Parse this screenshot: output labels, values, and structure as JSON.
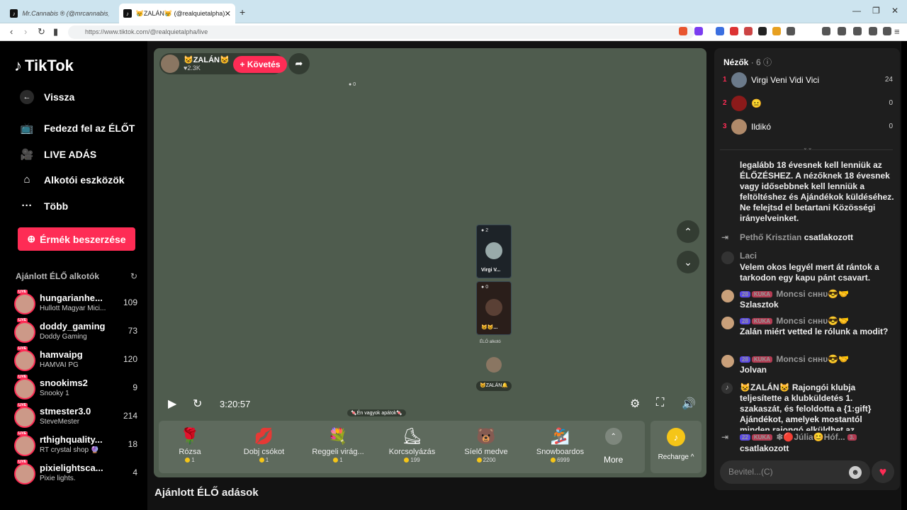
{
  "browser": {
    "tabs": [
      {
        "title": "Mr.Cannabis ® (@mrcannabis_",
        "active": false
      },
      {
        "title": "😿ZALÁN😿 (@realquietalpha)",
        "active": true
      }
    ],
    "url": "https://www.tiktok.com/@realquietalpha/live"
  },
  "sidebar": {
    "logo": "TikTok",
    "back": "Vissza",
    "nav": [
      "Fedezd fel az ÉLŐT",
      "LIVE ADÁS",
      "Alkotói eszközök",
      "Több"
    ],
    "coins_button": "Érmék beszerzése",
    "recommended_title": "Ajánlott ÉLŐ alkotók",
    "live_badge": "LIVE",
    "creators": [
      {
        "name": "hungarianhe...",
        "sub": "Hullott Magyar Mici...",
        "count": "109"
      },
      {
        "name": "doddy_gaming",
        "sub": "Doddy Gaming",
        "count": "73"
      },
      {
        "name": "hamvaipg",
        "sub": "HAMVAI PG",
        "count": "120"
      },
      {
        "name": "snookims2",
        "sub": "Snooky 1",
        "count": "9"
      },
      {
        "name": "stmester3.0",
        "sub": "SteveMester",
        "count": "214"
      },
      {
        "name": "rthighquality...",
        "sub": "RT crystal shop 🔮",
        "count": "18"
      },
      {
        "name": "pixielightsca...",
        "sub": "Pixie lights.",
        "count": "4"
      }
    ]
  },
  "bottom_heading": "Ajánlott ÉLŐ adások",
  "stage": {
    "host_name": "😺ZALÁN😺",
    "host_likes": "♥2.3K",
    "follow": "+ Követés",
    "top_count": "0",
    "guests": [
      {
        "count": "2",
        "name": "Virgi V..."
      },
      {
        "count": "0",
        "name": "😺😺..."
      }
    ],
    "live_creator_label": "ÉLŐ alkotó",
    "host_mini_label": "😺ZALÁN🔔",
    "time": "3:20:57",
    "banner": "🍬Én vagyok apátok🍬",
    "gifts": [
      {
        "name": "Rózsa",
        "price": "1",
        "icon": "🌹"
      },
      {
        "name": "Dobj csókot",
        "price": "1",
        "icon": "💋"
      },
      {
        "name": "Reggeli virág...",
        "price": "1",
        "icon": "💐"
      },
      {
        "name": "Korcsolyázás",
        "price": "199",
        "icon": "⛸"
      },
      {
        "name": "Síelő medve",
        "price": "2200",
        "icon": "🐻"
      },
      {
        "name": "Snowboardos",
        "price": "6999",
        "icon": "🏂"
      }
    ],
    "more": "More",
    "recharge": "Recharge ^"
  },
  "chat": {
    "viewers_title": "Nézők",
    "viewers_count": "· 6",
    "viewers": [
      {
        "rank": "1",
        "name": "Virgi Veni Vidi Vici",
        "score": "24"
      },
      {
        "rank": "2",
        "name": "😐",
        "score": "0"
      },
      {
        "rank": "3",
        "name": "Ildikó",
        "score": "0"
      }
    ],
    "notice": "legalább 18 évesnek kell lenniük az ÉLŐZÉSHEZ. A nézőknek 18 évesnek vagy idősebbnek kell lenniük a feltöltéshez és Ajándékok küldéséhez. Ne felejtsd el betartani Közösségi irányelveinket.",
    "join1_user": "Pethő Krisztian",
    "join1_text": "csatlakozott",
    "laci_user": "Laci",
    "laci_text": "Velem okos legyél mert át rántok a tarkodon egy kapu pánt csavart.",
    "badge_level": "28",
    "badge_club": "KUKA",
    "moncsi": "Moncsi ᴄʜʜᴜ😎🤝",
    "m1": "Szlasztok",
    "m2": "Zalán miért vetted le rólunk a modit?",
    "m3": "Jolvan",
    "club_msg": "😺ZALÁN😺 Rajongói klubja teljesítette a klubküldetés 1. szakaszát, és feloldotta a {1:gift} Ajándékot, amelyek mostantól minden rajongó elküldhet az ünnepléshez.",
    "join2_badge": "22",
    "join2_club": "KUKA",
    "join2_user": "❄🔴Júlia😊Hóf...",
    "join2_lvl": "3.",
    "join2_text": "csatlakozott",
    "input_placeholder": "Bevitel...(C)"
  }
}
